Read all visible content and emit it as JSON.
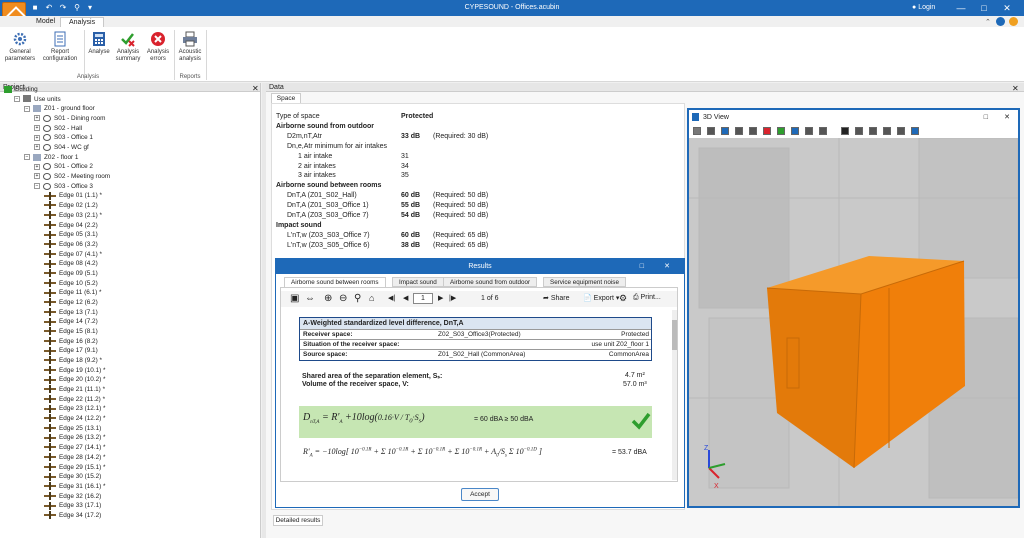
{
  "app": {
    "title": "CYPESOUND - Offices.acubin",
    "login": "Login"
  },
  "tabs": [
    "Model",
    "Analysis"
  ],
  "ribbon": {
    "buttons": [
      {
        "label": "General\nparameters",
        "icon": "gear-icon"
      },
      {
        "label": "Report\nconfiguration",
        "icon": "report-icon"
      },
      {
        "label": "Analyse",
        "icon": "calculator-icon"
      },
      {
        "label": "Analysis\nsummary",
        "icon": "check-cross-icon"
      },
      {
        "label": "Analysis\nerrors",
        "icon": "error-icon"
      },
      {
        "label": "Acoustic\nanalysis",
        "icon": "printer-icon"
      }
    ],
    "groups": {
      "analysis": "Analysis",
      "reports": "Reports"
    }
  },
  "project": {
    "header": "Project",
    "tree": [
      {
        "label": "Building",
        "lvl": 0,
        "type": "building"
      },
      {
        "label": "Use units",
        "lvl": 1,
        "type": "folder"
      },
      {
        "label": "Z01 - ground floor",
        "lvl": 2,
        "type": "floor"
      },
      {
        "label": "S01 - Dining room",
        "lvl": 3,
        "type": "space"
      },
      {
        "label": "S02 - Hall",
        "lvl": 3,
        "type": "space"
      },
      {
        "label": "S03 - Office 1",
        "lvl": 3,
        "type": "space"
      },
      {
        "label": "S04 - WC gf",
        "lvl": 3,
        "type": "space"
      },
      {
        "label": "Z02 - floor 1",
        "lvl": 2,
        "type": "floor"
      },
      {
        "label": "S01 - Office 2",
        "lvl": 3,
        "type": "space"
      },
      {
        "label": "S02 - Meeting room",
        "lvl": 3,
        "type": "space"
      },
      {
        "label": "S03 - Office 3",
        "lvl": 3,
        "type": "space"
      },
      {
        "label": "Edge 01   (1.1) *",
        "lvl": 4,
        "type": "edge"
      },
      {
        "label": "Edge 02   (1.2)",
        "lvl": 4,
        "type": "edge"
      },
      {
        "label": "Edge 03   (2.1) *",
        "lvl": 4,
        "type": "edge"
      },
      {
        "label": "Edge 04   (2.2)",
        "lvl": 4,
        "type": "edge"
      },
      {
        "label": "Edge 05   (3.1)",
        "lvl": 4,
        "type": "edge"
      },
      {
        "label": "Edge 06   (3.2)",
        "lvl": 4,
        "type": "edge"
      },
      {
        "label": "Edge 07   (4.1) *",
        "lvl": 4,
        "type": "edge"
      },
      {
        "label": "Edge 08   (4.2)",
        "lvl": 4,
        "type": "edge"
      },
      {
        "label": "Edge 09   (5.1)",
        "lvl": 4,
        "type": "edge"
      },
      {
        "label": "Edge 10   (5.2)",
        "lvl": 4,
        "type": "edge"
      },
      {
        "label": "Edge 11   (6.1) *",
        "lvl": 4,
        "type": "edge"
      },
      {
        "label": "Edge 12   (6.2)",
        "lvl": 4,
        "type": "edge"
      },
      {
        "label": "Edge 13   (7.1)",
        "lvl": 4,
        "type": "edge"
      },
      {
        "label": "Edge 14   (7.2)",
        "lvl": 4,
        "type": "edge"
      },
      {
        "label": "Edge 15   (8.1)",
        "lvl": 4,
        "type": "edge"
      },
      {
        "label": "Edge 16   (8.2)",
        "lvl": 4,
        "type": "edge"
      },
      {
        "label": "Edge 17   (9.1)",
        "lvl": 4,
        "type": "edge"
      },
      {
        "label": "Edge 18   (9.2) *",
        "lvl": 4,
        "type": "edge"
      },
      {
        "label": "Edge 19   (10.1) *",
        "lvl": 4,
        "type": "edge"
      },
      {
        "label": "Edge 20   (10.2) *",
        "lvl": 4,
        "type": "edge"
      },
      {
        "label": "Edge 21   (11.1) *",
        "lvl": 4,
        "type": "edge"
      },
      {
        "label": "Edge 22   (11.2) *",
        "lvl": 4,
        "type": "edge"
      },
      {
        "label": "Edge 23   (12.1) *",
        "lvl": 4,
        "type": "edge"
      },
      {
        "label": "Edge 24   (12.2) *",
        "lvl": 4,
        "type": "edge"
      },
      {
        "label": "Edge 25   (13.1)",
        "lvl": 4,
        "type": "edge"
      },
      {
        "label": "Edge 26   (13.2) *",
        "lvl": 4,
        "type": "edge"
      },
      {
        "label": "Edge 27   (14.1) *",
        "lvl": 4,
        "type": "edge"
      },
      {
        "label": "Edge 28   (14.2) *",
        "lvl": 4,
        "type": "edge"
      },
      {
        "label": "Edge 29   (15.1) *",
        "lvl": 4,
        "type": "edge"
      },
      {
        "label": "Edge 30   (15.2)",
        "lvl": 4,
        "type": "edge"
      },
      {
        "label": "Edge 31   (16.1) *",
        "lvl": 4,
        "type": "edge"
      },
      {
        "label": "Edge 32   (16.2)",
        "lvl": 4,
        "type": "edge"
      },
      {
        "label": "Edge 33   (17.1)",
        "lvl": 4,
        "type": "edge"
      },
      {
        "label": "Edge 34   (17.2)",
        "lvl": 4,
        "type": "edge"
      }
    ]
  },
  "data": {
    "header": "Data",
    "tab": "Space",
    "report": [
      {
        "l": "Type of space",
        "v": "Protected",
        "r": "",
        "indent": 0,
        "head": false
      },
      {
        "l": "Airborne sound from outdoor",
        "v": "",
        "r": "",
        "indent": 0,
        "head": true
      },
      {
        "l": "D2m,nT,Atr",
        "v": "33 dB",
        "r": "(Required: 30 dB)",
        "indent": 1,
        "head": false
      },
      {
        "l": "Dn,e,Atr minimum for air intakes",
        "v": "",
        "r": "",
        "indent": 1,
        "head": false
      },
      {
        "l": "1 air intake",
        "v": "31",
        "r": "",
        "indent": 2,
        "head": false
      },
      {
        "l": "2 air intakes",
        "v": "34",
        "r": "",
        "indent": 2,
        "head": false
      },
      {
        "l": "3 air intakes",
        "v": "35",
        "r": "",
        "indent": 2,
        "head": false
      },
      {
        "l": "Airborne sound between rooms",
        "v": "",
        "r": "",
        "indent": 0,
        "head": true
      },
      {
        "l": "DnT,A (Z01_S02_Hall)",
        "v": "60 dB",
        "r": "(Required: 50 dB)",
        "indent": 1,
        "head": false
      },
      {
        "l": "DnT,A (Z01_S03_Office 1)",
        "v": "55 dB",
        "r": "(Required: 50 dB)",
        "indent": 1,
        "head": false
      },
      {
        "l": "DnT,A (Z03_S03_Office 7)",
        "v": "54 dB",
        "r": "(Required: 50 dB)",
        "indent": 1,
        "head": false
      },
      {
        "l": "Impact sound",
        "v": "",
        "r": "",
        "indent": 0,
        "head": true
      },
      {
        "l": "L'nT,w (Z03_S03_Office 7)",
        "v": "60 dB",
        "r": "(Required: 65 dB)",
        "indent": 1,
        "head": false
      },
      {
        "l": "L'nT,w (Z03_S05_Office 6)",
        "v": "38 dB",
        "r": "(Required: 65 dB)",
        "indent": 1,
        "head": false
      }
    ],
    "detailed": "Detailed results"
  },
  "results": {
    "title": "Results",
    "tabs": [
      "Airborne sound between rooms",
      "Impact sound",
      "Airborne sound from outdoor",
      "Service equipment noise"
    ],
    "page_current": "1",
    "page_info": "1 of 6",
    "share": "Share",
    "export": "Export",
    "print": "Print...",
    "table_title": "A-Weighted standardized level difference, DnT,A",
    "rows": [
      {
        "l": "Receiver space:",
        "m": "Z02_S03_Office3(Protected)",
        "r": "Protected"
      },
      {
        "l": "Situation of the receiver space:",
        "m": "",
        "r": "use unit Z02_floor 1"
      },
      {
        "l": "Source space:",
        "m": "Z01_S02_Hall (CommonArea)",
        "r": "CommonArea"
      }
    ],
    "area_label": "Shared area of the separation element, Sₛ:",
    "area_value": "4.7 m²",
    "volume_label": "Volume of the receiver space, V:",
    "volume_value": "57.0 m³",
    "formula1_lhs": "D",
    "formula1_rhs": "= 60 dBA ≥ 50 dBA",
    "formula2_rhs": "= 53.7 dBA",
    "accept": "Accept"
  },
  "view3d": {
    "title": "3D View"
  },
  "colors": {
    "accent": "#1e69b8",
    "object": "#f07f0a",
    "pass": "#2e9e2e",
    "error": "#d9232d"
  }
}
